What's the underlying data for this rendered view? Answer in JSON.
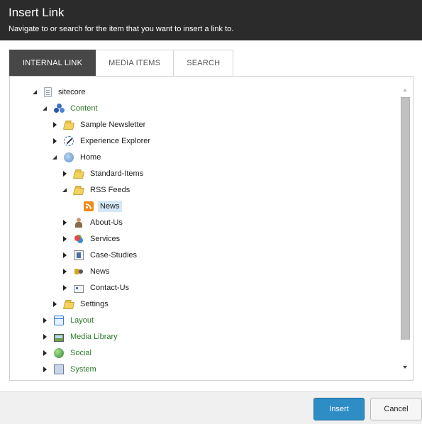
{
  "dialog": {
    "title": "Insert Link",
    "subtitle": "Navigate to or search for the item that you want to insert a link to."
  },
  "tabs": [
    {
      "label": "INTERNAL LINK",
      "active": true
    },
    {
      "label": "MEDIA ITEMS",
      "active": false
    },
    {
      "label": "SEARCH",
      "active": false
    }
  ],
  "tree": {
    "items": [
      {
        "label": "sitecore",
        "icon": "page-icon"
      },
      {
        "label": "Content",
        "icon": "content-icon"
      },
      {
        "label": "Sample Newsletter",
        "icon": "folder-icon"
      },
      {
        "label": "Experience Explorer",
        "icon": "explorer-icon"
      },
      {
        "label": "Home",
        "icon": "home-icon"
      },
      {
        "label": "Standard-Items",
        "icon": "folder-icon"
      },
      {
        "label": "RSS Feeds",
        "icon": "folder-icon"
      },
      {
        "label": "News",
        "icon": "rss-icon",
        "selected": true
      },
      {
        "label": "About-Us",
        "icon": "person-icon"
      },
      {
        "label": "Services",
        "icon": "services-icon"
      },
      {
        "label": "Case-Studies",
        "icon": "case-icon"
      },
      {
        "label": "News",
        "icon": "news-icon"
      },
      {
        "label": "Contact-Us",
        "icon": "contact-icon"
      },
      {
        "label": "Settings",
        "icon": "folder-icon"
      },
      {
        "label": "Layout",
        "icon": "layout-icon"
      },
      {
        "label": "Media Library",
        "icon": "media-icon"
      },
      {
        "label": "Social",
        "icon": "social-icon"
      },
      {
        "label": "System",
        "icon": "system-icon"
      }
    ]
  },
  "footer": {
    "insert_label": "Insert",
    "cancel_label": "Cancel"
  },
  "colors": {
    "header_bg": "#2b2b2b",
    "active_tab_bg": "#474747",
    "primary_button": "#2f8dc6",
    "tree_green_text": "#2b7a2b",
    "selection_bg": "#d5e8f5"
  }
}
